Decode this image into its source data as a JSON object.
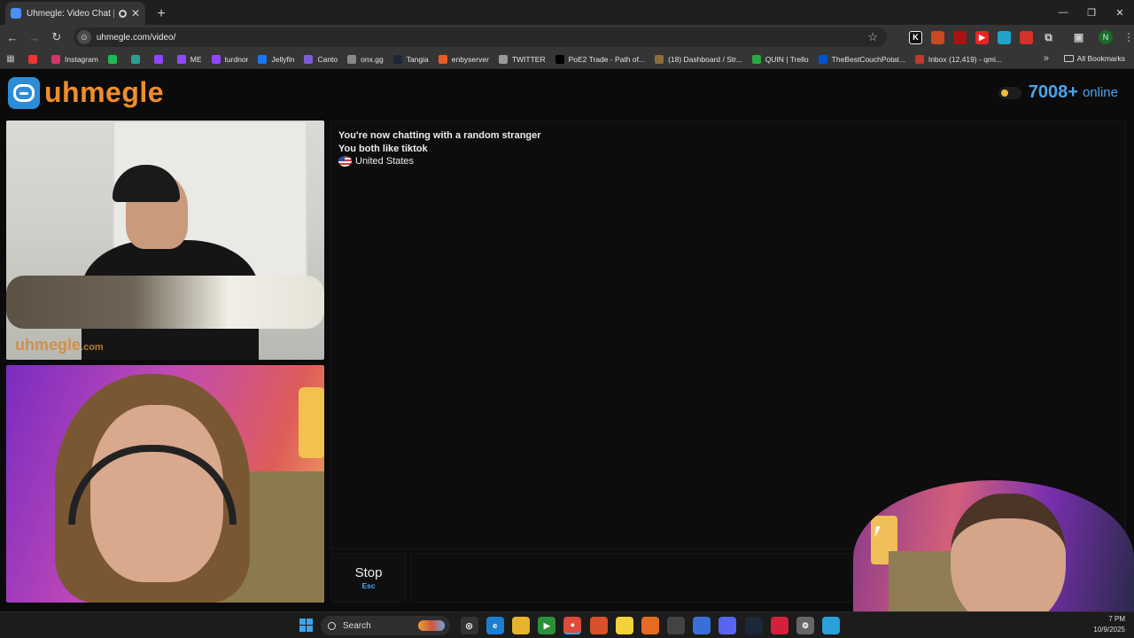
{
  "browser": {
    "tab_title": "Uhmegle: Video Chat | Ome",
    "new_tab": "+",
    "url": "uhmegle.com/video/",
    "window_controls": [
      "—",
      "❐",
      "✕"
    ],
    "bookmarks": [
      {
        "label": "",
        "color": "#e33"
      },
      {
        "label": "Instagram",
        "color": "#d6336c"
      },
      {
        "label": "",
        "color": "#1db954"
      },
      {
        "label": "",
        "color": "#2aa18e"
      },
      {
        "label": "",
        "color": "#9147ff"
      },
      {
        "label": "ME",
        "color": "#9147ff"
      },
      {
        "label": "turdnor",
        "color": "#9147ff"
      },
      {
        "label": "Jellyfin",
        "color": "#1877f2"
      },
      {
        "label": "Canto",
        "color": "#7b5cd6"
      },
      {
        "label": "onx.gg",
        "color": "#888"
      },
      {
        "label": "Tangia",
        "color": "#1b2838"
      },
      {
        "label": "enbyserver",
        "color": "#e85d27"
      },
      {
        "label": "TWITTER",
        "color": "#999"
      },
      {
        "label": "PoE2 Trade - Path of...",
        "color": "#000"
      },
      {
        "label": "(18) Dashboard / Str...",
        "color": "#8a6d3b"
      },
      {
        "label": "QUIN | Trello",
        "color": "#28a745"
      },
      {
        "label": "TheBestCouchPotat...",
        "color": "#0052cc"
      },
      {
        "label": "Inbox (12,419) - qmi...",
        "color": "#c0392b"
      }
    ],
    "all_bookmarks": "All Bookmarks",
    "profile_initial": "N"
  },
  "site": {
    "logo_text": "uhmegle",
    "online_count": "7008+",
    "online_label": "online"
  },
  "chat": {
    "lines": [
      "You're now chatting with a random stranger",
      "You both like tiktok"
    ],
    "country": "United States"
  },
  "controls": {
    "stop_label": "Stop",
    "stop_key": "Esc"
  },
  "video": {
    "watermark": "uhmegle",
    "watermark_suffix": ".com"
  },
  "taskbar": {
    "search_label": "Search",
    "clock_time": "7 PM",
    "clock_date": "10/9/2025"
  }
}
